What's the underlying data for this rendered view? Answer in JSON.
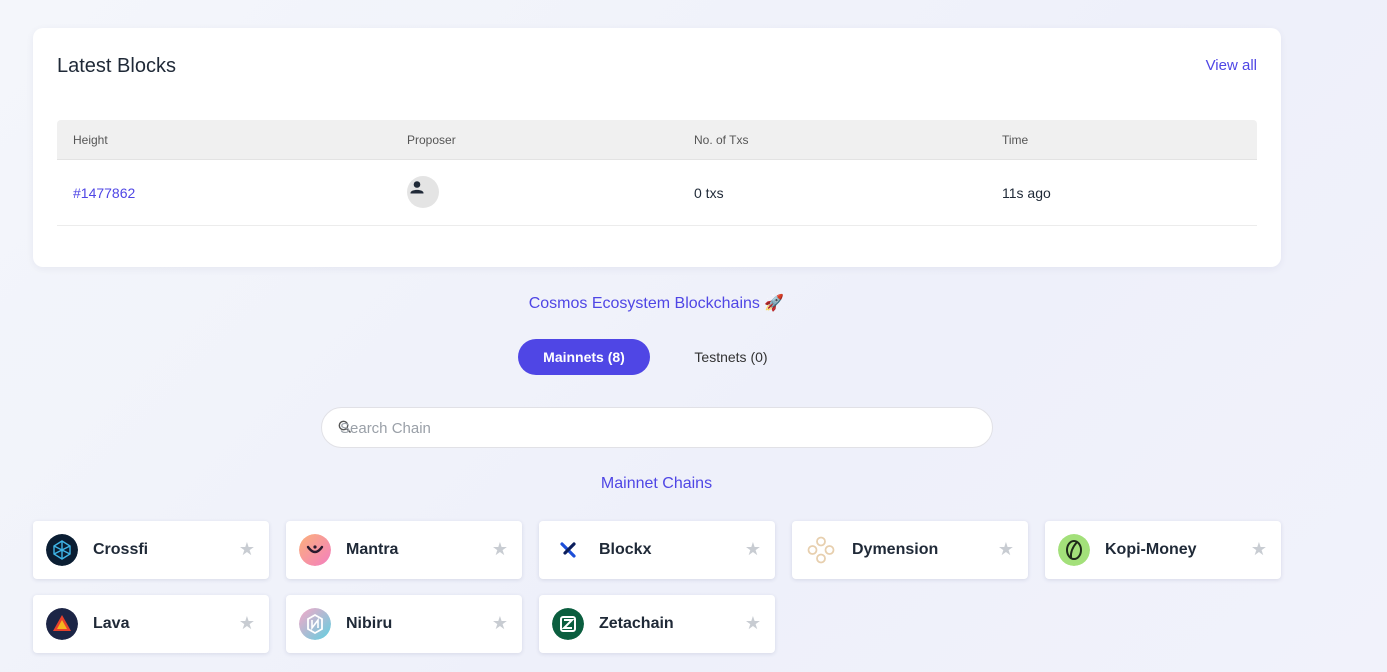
{
  "latest_blocks": {
    "title": "Latest Blocks",
    "view_all": "View all",
    "columns": [
      "Height",
      "Proposer",
      "No. of Txs",
      "Time"
    ],
    "rows": [
      {
        "height": "#1477862",
        "txs": "0 txs",
        "time": "11s ago"
      }
    ]
  },
  "ecosystem_title": "Cosmos Ecosystem Blockchains 🚀",
  "tabs": {
    "mainnets": "Mainnets (8)",
    "testnets": "Testnets (0)"
  },
  "search": {
    "placeholder": "Search Chain"
  },
  "chains_title": "Mainnet Chains",
  "chains": [
    {
      "name": "Crossfi",
      "icon": "crossfi-logo",
      "color": "#0b1e33"
    },
    {
      "name": "Mantra",
      "icon": "mantra-logo",
      "color": "#f59ab5"
    },
    {
      "name": "Blockx",
      "icon": "blockx-logo",
      "color": "#1d4ed8"
    },
    {
      "name": "Dymension",
      "icon": "dymension-logo",
      "color": "#e9d3b8"
    },
    {
      "name": "Kopi-Money",
      "icon": "kopi-money-logo",
      "color": "#a3e07a"
    },
    {
      "name": "Lava",
      "icon": "lava-logo",
      "color": "#1c2546"
    },
    {
      "name": "Nibiru",
      "icon": "nibiru-logo",
      "color": "#7dd3e0"
    },
    {
      "name": "Zetachain",
      "icon": "zetachain-logo",
      "color": "#0b5e3f"
    }
  ]
}
